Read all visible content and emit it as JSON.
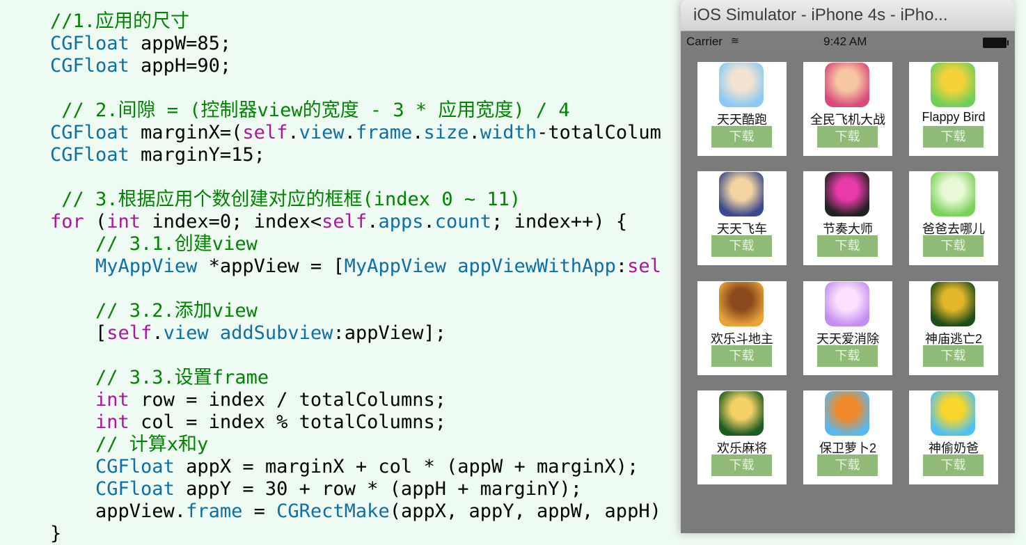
{
  "editor": {
    "lines": [
      {
        "segments": [
          {
            "t": "//1.应用的尺寸",
            "c": "cm"
          }
        ]
      },
      {
        "segments": [
          {
            "t": "CGFloat",
            "c": "ty"
          },
          {
            "t": " appW=85;",
            "c": "pl"
          }
        ]
      },
      {
        "segments": [
          {
            "t": "CGFloat",
            "c": "ty"
          },
          {
            "t": " appH=90;",
            "c": "pl"
          }
        ]
      },
      {
        "segments": [
          {
            "t": "",
            "c": "pl"
          }
        ]
      },
      {
        "segments": [
          {
            "t": " // 2.间隙 = (控制器view的宽度 - 3 * 应用宽度) / 4",
            "c": "cm"
          }
        ]
      },
      {
        "segments": [
          {
            "t": "CGFloat",
            "c": "ty"
          },
          {
            "t": " marginX=(",
            "c": "pl"
          },
          {
            "t": "self",
            "c": "kw"
          },
          {
            "t": ".",
            "c": "pl"
          },
          {
            "t": "view",
            "c": "ty"
          },
          {
            "t": ".",
            "c": "pl"
          },
          {
            "t": "frame",
            "c": "ty"
          },
          {
            "t": ".",
            "c": "pl"
          },
          {
            "t": "size",
            "c": "ty"
          },
          {
            "t": ".",
            "c": "pl"
          },
          {
            "t": "width",
            "c": "ty"
          },
          {
            "t": "-totalColum",
            "c": "pl"
          }
        ]
      },
      {
        "segments": [
          {
            "t": "CGFloat",
            "c": "ty"
          },
          {
            "t": " marginY=15;",
            "c": "pl"
          }
        ]
      },
      {
        "segments": [
          {
            "t": "",
            "c": "pl"
          }
        ]
      },
      {
        "segments": [
          {
            "t": " // 3.根据应用个数创建对应的框框(index 0 ~ 11)",
            "c": "cm"
          }
        ]
      },
      {
        "segments": [
          {
            "t": "for",
            "c": "kw"
          },
          {
            "t": " (",
            "c": "pl"
          },
          {
            "t": "int",
            "c": "kw"
          },
          {
            "t": " index=0; index<",
            "c": "pl"
          },
          {
            "t": "self",
            "c": "kw"
          },
          {
            "t": ".",
            "c": "pl"
          },
          {
            "t": "apps",
            "c": "ty"
          },
          {
            "t": ".",
            "c": "pl"
          },
          {
            "t": "count",
            "c": "ty"
          },
          {
            "t": "; index++) {",
            "c": "pl"
          }
        ]
      },
      {
        "segments": [
          {
            "t": "    // 3.1.创建view",
            "c": "cm"
          }
        ]
      },
      {
        "segments": [
          {
            "t": "    ",
            "c": "pl"
          },
          {
            "t": "MyAppView",
            "c": "ty"
          },
          {
            "t": " *appView = [",
            "c": "pl"
          },
          {
            "t": "MyAppView",
            "c": "ty"
          },
          {
            "t": " ",
            "c": "pl"
          },
          {
            "t": "appViewWithApp",
            "c": "ty"
          },
          {
            "t": ":",
            "c": "pl"
          },
          {
            "t": "sel",
            "c": "kw"
          }
        ]
      },
      {
        "segments": [
          {
            "t": "",
            "c": "pl"
          }
        ]
      },
      {
        "segments": [
          {
            "t": "    // 3.2.添加view",
            "c": "cm"
          }
        ]
      },
      {
        "segments": [
          {
            "t": "    [",
            "c": "pl"
          },
          {
            "t": "self",
            "c": "kw"
          },
          {
            "t": ".",
            "c": "pl"
          },
          {
            "t": "view",
            "c": "ty"
          },
          {
            "t": " ",
            "c": "pl"
          },
          {
            "t": "addSubview",
            "c": "ty"
          },
          {
            "t": ":appView];",
            "c": "pl"
          }
        ]
      },
      {
        "segments": [
          {
            "t": "",
            "c": "pl"
          }
        ]
      },
      {
        "segments": [
          {
            "t": "    // 3.3.设置frame",
            "c": "cm"
          }
        ]
      },
      {
        "segments": [
          {
            "t": "    ",
            "c": "pl"
          },
          {
            "t": "int",
            "c": "kw"
          },
          {
            "t": " row = index / totalColumns;",
            "c": "pl"
          }
        ]
      },
      {
        "segments": [
          {
            "t": "    ",
            "c": "pl"
          },
          {
            "t": "int",
            "c": "kw"
          },
          {
            "t": " col = index % totalColumns;",
            "c": "pl"
          }
        ]
      },
      {
        "segments": [
          {
            "t": "    // 计算x和y",
            "c": "cm"
          }
        ]
      },
      {
        "segments": [
          {
            "t": "    ",
            "c": "pl"
          },
          {
            "t": "CGFloat",
            "c": "ty"
          },
          {
            "t": " appX = marginX + col * (appW + marginX);",
            "c": "pl"
          }
        ]
      },
      {
        "segments": [
          {
            "t": "    ",
            "c": "pl"
          },
          {
            "t": "CGFloat",
            "c": "ty"
          },
          {
            "t": " appY = 30 + row * (appH + marginY);",
            "c": "pl"
          }
        ]
      },
      {
        "segments": [
          {
            "t": "    appView.",
            "c": "pl"
          },
          {
            "t": "frame",
            "c": "ty"
          },
          {
            "t": " = ",
            "c": "pl"
          },
          {
            "t": "CGRectMake",
            "c": "ty"
          },
          {
            "t": "(appX, appY, appW, appH)",
            "c": "pl"
          }
        ]
      },
      {
        "segments": [
          {
            "t": "}",
            "c": "pl"
          }
        ]
      }
    ]
  },
  "simulator": {
    "title": "iOS Simulator - iPhone 4s - iPho...",
    "status": {
      "carrier": "Carrier",
      "wifi": "≋",
      "time": "9:42 AM"
    },
    "apps": [
      {
        "name": "天天酷跑",
        "button": "下载",
        "icon": "game-runner-icon",
        "colors": [
          "#8bc9f3",
          "#f2e3d2"
        ]
      },
      {
        "name": "全民飞机大战",
        "button": "下载",
        "icon": "game-pilot-icon",
        "colors": [
          "#d94a7a",
          "#f7c6a3"
        ]
      },
      {
        "name": "Flappy Bird",
        "button": "下载",
        "icon": "flappy-bird-icon",
        "colors": [
          "#6fcf5b",
          "#f5d23a"
        ]
      },
      {
        "name": "天天飞车",
        "button": "下载",
        "icon": "game-racer-icon",
        "colors": [
          "#3b4a8e",
          "#f3d3a0"
        ]
      },
      {
        "name": "节奏大师",
        "button": "下载",
        "icon": "music-master-icon",
        "colors": [
          "#222",
          "#e83aa8"
        ]
      },
      {
        "name": "爸爸去哪儿",
        "button": "下载",
        "icon": "dad-where-icon",
        "colors": [
          "#7bd15b",
          "#e9f8d6"
        ]
      },
      {
        "name": "欢乐斗地主",
        "button": "下载",
        "icon": "landlord-game-icon",
        "colors": [
          "#e8a23a",
          "#8a4a1d"
        ]
      },
      {
        "name": "天天爱消除",
        "button": "下载",
        "icon": "match-game-icon",
        "colors": [
          "#c48ef0",
          "#fbe1ff"
        ]
      },
      {
        "name": "神庙逃亡2",
        "button": "下载",
        "icon": "temple-run-icon",
        "colors": [
          "#1f4d1a",
          "#e3b62a"
        ]
      },
      {
        "name": "欢乐麻将",
        "button": "下载",
        "icon": "mahjong-icon",
        "colors": [
          "#1b5b24",
          "#f3d166"
        ]
      },
      {
        "name": "保卫萝卜2",
        "button": "下载",
        "icon": "carrot-defense-icon",
        "colors": [
          "#59b7ef",
          "#f08a2a"
        ]
      },
      {
        "name": "神偷奶爸",
        "button": "下载",
        "icon": "minion-icon",
        "colors": [
          "#4ec1f2",
          "#f6d62a"
        ]
      }
    ]
  }
}
